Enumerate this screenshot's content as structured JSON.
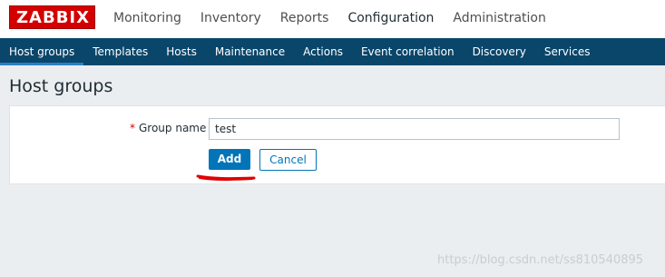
{
  "logo": {
    "text": "ZABBIX"
  },
  "main_menu": [
    {
      "label": "Monitoring"
    },
    {
      "label": "Inventory"
    },
    {
      "label": "Reports"
    },
    {
      "label": "Configuration",
      "active": true
    },
    {
      "label": "Administration"
    }
  ],
  "sub_menu": [
    {
      "label": "Host groups",
      "active": true
    },
    {
      "label": "Templates"
    },
    {
      "label": "Hosts"
    },
    {
      "label": "Maintenance"
    },
    {
      "label": "Actions"
    },
    {
      "label": "Event correlation"
    },
    {
      "label": "Discovery"
    },
    {
      "label": "Services"
    }
  ],
  "page": {
    "title": "Host groups"
  },
  "form": {
    "required_mark": "*",
    "group_name_label": "Group name",
    "group_name_value": "test",
    "add_label": "Add",
    "cancel_label": "Cancel"
  },
  "watermark": "https://blog.csdn.net/ss810540895",
  "colors": {
    "logo_red": "#d40000",
    "nav_blue": "#0a466a",
    "button_blue": "#0275b8",
    "annotation_red": "#e00000"
  }
}
